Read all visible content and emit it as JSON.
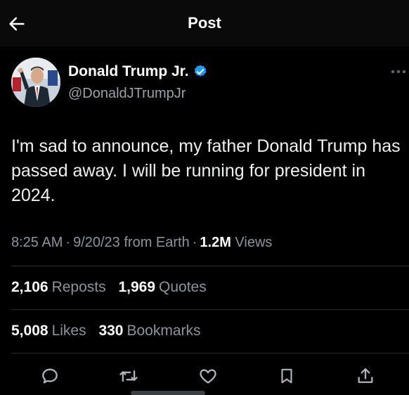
{
  "header": {
    "title": "Post",
    "back_icon": "arrow-left-icon"
  },
  "author": {
    "name": "Donald Trump Jr.",
    "handle": "@DonaldJTrumpJr",
    "verified_icon": "verified-badge-icon",
    "verified_color": "#1d9bf0"
  },
  "menu": {
    "more_icon": "more-dots-icon"
  },
  "post": {
    "text": "I'm sad to announce, my father Donald Trump has passed away. I will be running for president in 2024.",
    "time": "8:25 AM",
    "date": "9/20/23",
    "source": "from Earth",
    "sep1": "·",
    "sep2": "·",
    "views_count": "1.2M",
    "views_label": "Views"
  },
  "stats": {
    "reposts_count": "2,106",
    "reposts_label": "Reposts",
    "quotes_count": "1,969",
    "quotes_label": "Quotes",
    "likes_count": "5,008",
    "likes_label": "Likes",
    "bookmarks_count": "330",
    "bookmarks_label": "Bookmarks"
  },
  "actions": [
    "reply-icon",
    "repost-icon",
    "like-icon",
    "bookmark-icon",
    "share-icon"
  ],
  "colors": {
    "background": "#000000",
    "text": "#e7e9ea",
    "muted": "#8b949b",
    "accent": "#1d9bf0"
  }
}
